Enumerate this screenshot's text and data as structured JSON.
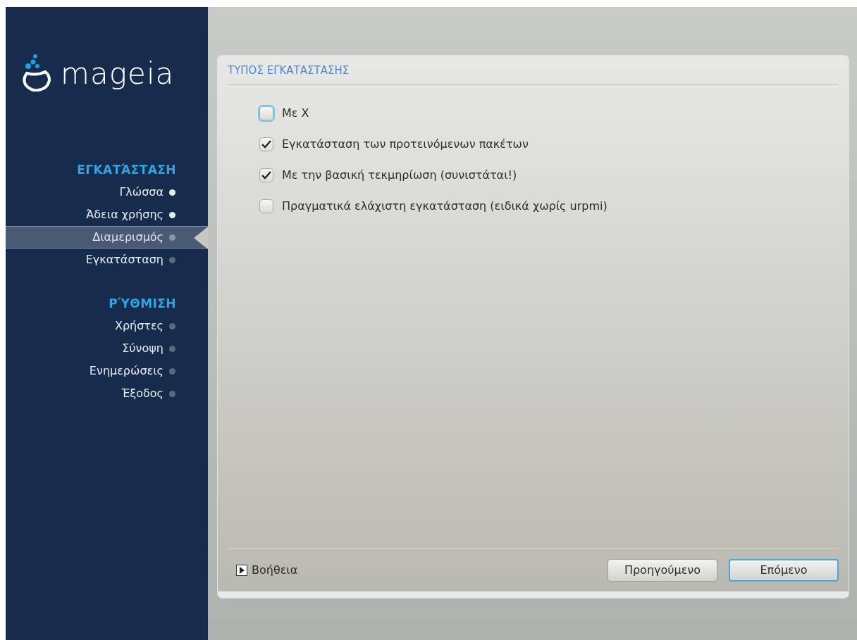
{
  "logo": "mageia",
  "sidebar": {
    "sections": [
      {
        "title": "ΕΓΚΑΤΆΣΤΑΣΗ",
        "items": [
          {
            "label": "Γλώσσα",
            "done": true,
            "selected": false
          },
          {
            "label": "Άδεια χρήσης",
            "done": true,
            "selected": false
          },
          {
            "label": "Διαμερισμός",
            "done": false,
            "selected": true
          },
          {
            "label": "Εγκατάσταση",
            "done": false,
            "selected": false
          }
        ]
      },
      {
        "title": "ΡΎΘΜΙΣΗ",
        "items": [
          {
            "label": "Χρήστες",
            "done": false,
            "selected": false
          },
          {
            "label": "Σύνοψη",
            "done": false,
            "selected": false
          },
          {
            "label": "Ενημερώσεις",
            "done": false,
            "selected": false
          },
          {
            "label": "Έξοδος",
            "done": false,
            "selected": false
          }
        ]
      }
    ]
  },
  "dialog": {
    "title": "ΤΥΠΟΣ ΕΓΚΑΤΑΣΤΑΣΗΣ",
    "options": [
      {
        "label": "Με X",
        "checked": false,
        "focused": true
      },
      {
        "label": "Εγκατάσταση των προτεινόμενων πακέτων",
        "checked": true,
        "focused": false
      },
      {
        "label": "Με την βασική τεκμηρίωση (συνιστάται!)",
        "checked": true,
        "focused": false
      },
      {
        "label": "Πραγματικά ελάχιστη εγκατάσταση (ειδικά χωρίς urpmi)",
        "checked": false,
        "focused": false
      }
    ],
    "help": "Βοήθεια",
    "buttons": [
      {
        "label": "Προηγούμενο",
        "focused": false
      },
      {
        "label": "Επόμενο",
        "focused": true
      }
    ]
  }
}
